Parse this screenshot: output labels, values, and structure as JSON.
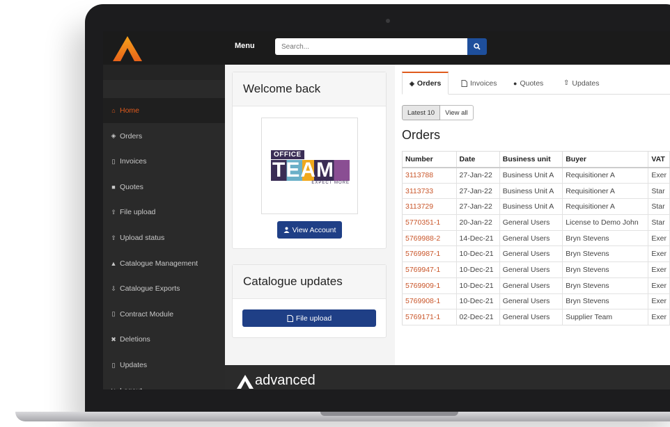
{
  "topbar": {
    "menu_label": "Menu",
    "search_placeholder": "Search..."
  },
  "sidebar": {
    "items": [
      {
        "label": "Home",
        "icon": "home-icon",
        "active": true
      },
      {
        "label": "Orders",
        "icon": "tags-icon"
      },
      {
        "label": "Invoices",
        "icon": "document-icon"
      },
      {
        "label": "Quotes",
        "icon": "truck-icon"
      },
      {
        "label": "File upload",
        "icon": "upload-icon"
      },
      {
        "label": "Upload status",
        "icon": "upload-icon"
      },
      {
        "label": "Catalogue Management",
        "icon": "user-icon"
      },
      {
        "label": "Catalogue Exports",
        "icon": "download-icon"
      },
      {
        "label": "Contract Module",
        "icon": "document-icon"
      },
      {
        "label": "Deletions",
        "icon": "close-icon"
      },
      {
        "label": "Updates",
        "icon": "document-icon"
      },
      {
        "label": "Logout",
        "icon": "logout-icon"
      }
    ]
  },
  "welcome": {
    "title": "Welcome back",
    "logo_top": "OFFICE",
    "logo_main": "TEAM",
    "logo_tagline": "EXPECT MORE",
    "view_account": "View Account"
  },
  "catalogue": {
    "title": "Catalogue updates",
    "file_upload": "File upload"
  },
  "tabs": [
    {
      "label": "Orders",
      "active": true
    },
    {
      "label": "Invoices"
    },
    {
      "label": "Quotes"
    },
    {
      "label": "Updates"
    }
  ],
  "filters": {
    "latest": "Latest 10",
    "view_all": "View all"
  },
  "orders": {
    "title": "Orders",
    "columns": [
      "Number",
      "Date",
      "Business unit",
      "Buyer",
      "VAT"
    ],
    "rows": [
      [
        "3113788",
        "27-Jan-22",
        "Business Unit A",
        "Requisitioner A",
        "Exer"
      ],
      [
        "3113733",
        "27-Jan-22",
        "Business Unit A",
        "Requisitioner A",
        "Star"
      ],
      [
        "3113729",
        "27-Jan-22",
        "Business Unit A",
        "Requisitioner A",
        "Star"
      ],
      [
        "5770351-1",
        "20-Jan-22",
        "General Users",
        "License to Demo John",
        "Star"
      ],
      [
        "5769988-2",
        "14-Dec-21",
        "General Users",
        "Bryn Stevens",
        "Exer"
      ],
      [
        "5769987-1",
        "10-Dec-21",
        "General Users",
        "Bryn Stevens",
        "Exer"
      ],
      [
        "5769947-1",
        "10-Dec-21",
        "General Users",
        "Bryn Stevens",
        "Exer"
      ],
      [
        "5769909-1",
        "10-Dec-21",
        "General Users",
        "Bryn Stevens",
        "Exer"
      ],
      [
        "5769908-1",
        "10-Dec-21",
        "General Users",
        "Bryn Stevens",
        "Exer"
      ],
      [
        "5769171-1",
        "02-Dec-21",
        "General Users",
        "Supplier Team",
        "Exer"
      ]
    ]
  },
  "footer": {
    "brand": "advanced"
  },
  "colors": {
    "accent": "#e05a1c",
    "primary": "#1f3f86",
    "sidebar": "#2a2a2a"
  }
}
